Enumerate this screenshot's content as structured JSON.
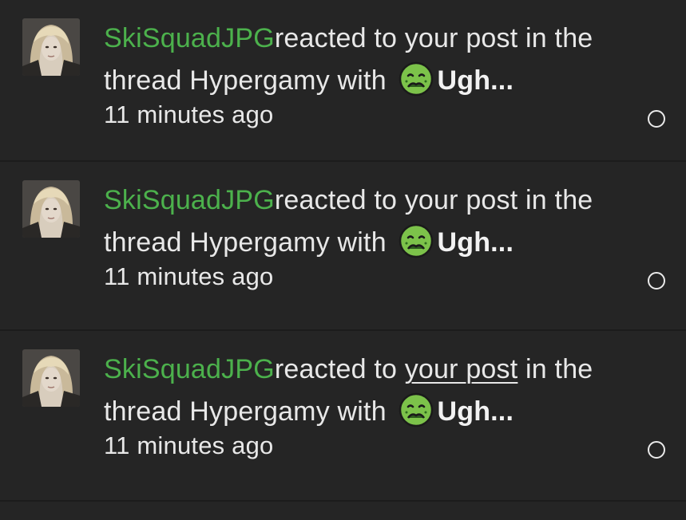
{
  "notifications": [
    {
      "user": "SkiSquadJPG",
      "action_prefix": "reacted to ",
      "post_link": "your post",
      "action_suffix": " in the thread ",
      "thread": "Hypergamy",
      "with_text": " with ",
      "reaction_icon": "nauseated-face-icon",
      "reaction": "Ugh...",
      "time": "11 minutes ago",
      "post_link_underlined": false
    },
    {
      "user": "SkiSquadJPG",
      "action_prefix": "reacted to ",
      "post_link": "your post",
      "action_suffix": " in the thread ",
      "thread": "Hypergamy",
      "with_text": " with ",
      "reaction_icon": "nauseated-face-icon",
      "reaction": "Ugh...",
      "time": "11 minutes ago",
      "post_link_underlined": false
    },
    {
      "user": "SkiSquadJPG",
      "action_prefix": "reacted to ",
      "post_link": "your post",
      "action_suffix": " in the thread ",
      "thread": "Hypergamy",
      "with_text": " with ",
      "reaction_icon": "nauseated-face-icon",
      "reaction": "Ugh...",
      "time": "11 minutes ago",
      "post_link_underlined": true
    }
  ],
  "colors": {
    "background": "#252525",
    "username": "#4cb14c",
    "text": "#e8e8e8",
    "emoji_face": "#7cc24a"
  }
}
